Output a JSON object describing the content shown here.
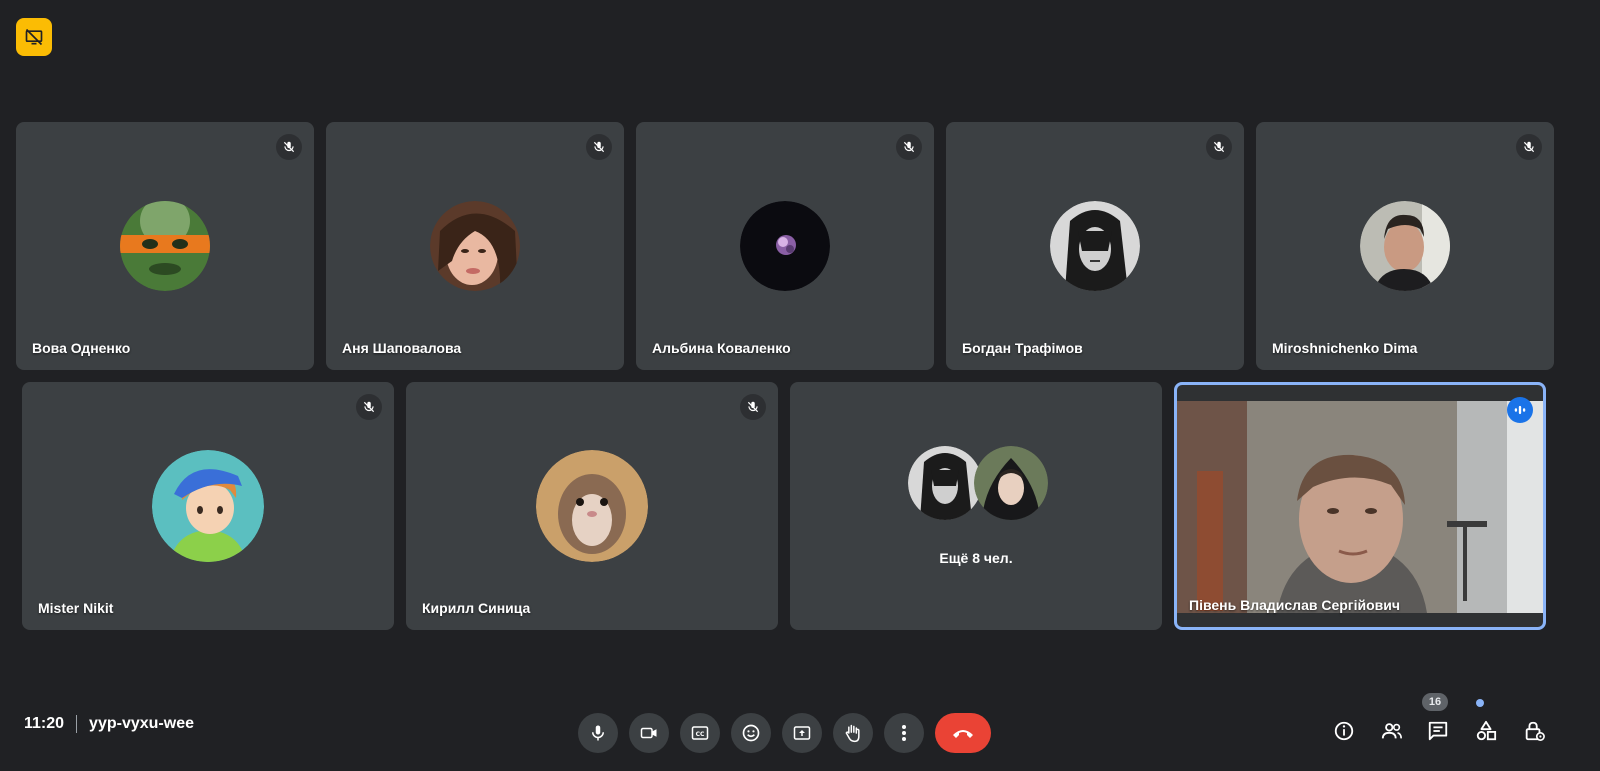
{
  "top_badge_icon": "presentation-off-icon",
  "participants": [
    {
      "name": "Вова Одненко",
      "muted": true
    },
    {
      "name": "Аня Шаповалова",
      "muted": true
    },
    {
      "name": "Альбина Коваленко",
      "muted": true
    },
    {
      "name": "Богдан Трафімов",
      "muted": true
    },
    {
      "name": "Miroshnichenko Dima",
      "muted": true
    },
    {
      "name": "Mister Nikit",
      "muted": true
    },
    {
      "name": "Кирилл Синица",
      "muted": true
    },
    {
      "name": "Півень Владислав Сергійович",
      "muted": false,
      "speaking": true
    }
  ],
  "more_tile": {
    "label": "Ещё 8 чел."
  },
  "bottom_bar": {
    "time": "11:20",
    "meeting_code": "yyp-vyxu-wee",
    "controls": [
      "microphone-icon",
      "camera-icon",
      "captions-icon",
      "emoji-icon",
      "present-screen-icon",
      "raise-hand-icon",
      "more-options-icon",
      "hang-up-icon"
    ],
    "people_count": "16",
    "right_icons": [
      "info-icon",
      "people-icon",
      "chat-icon",
      "activities-icon",
      "host-controls-icon"
    ]
  },
  "colors": {
    "background": "#202124",
    "tile": "#3c4043",
    "hangup": "#ea4335",
    "accent": "#8ab4f8",
    "badge": "#fbbc04"
  }
}
